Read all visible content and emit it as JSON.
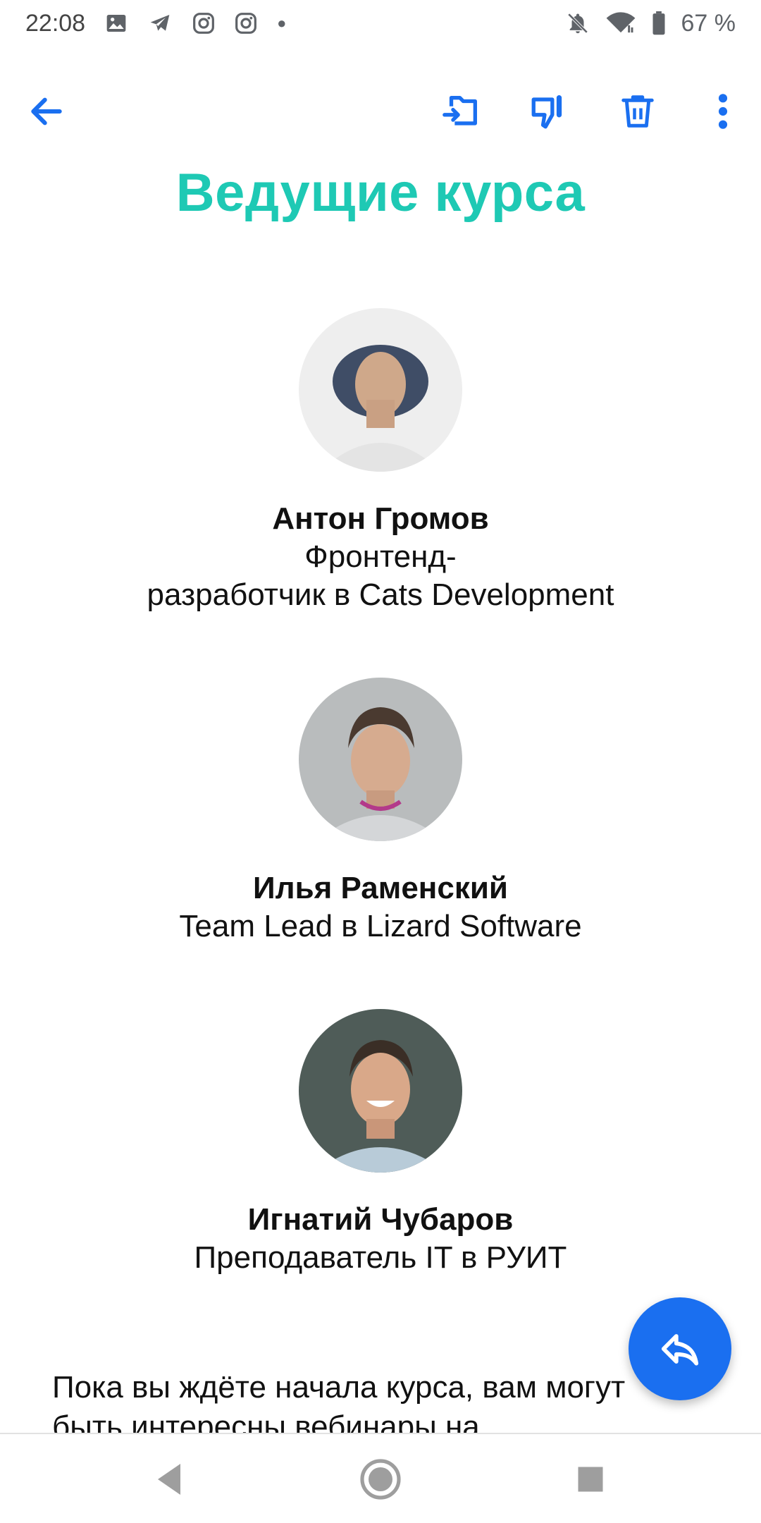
{
  "status_bar": {
    "time": "22:08",
    "battery": "67 %",
    "notification_icons": [
      "image-icon",
      "telegram-icon",
      "instagram-icon",
      "instagram-icon"
    ],
    "system_icons": [
      "bell-off-icon",
      "wifi-icon",
      "battery-icon"
    ]
  },
  "app_bar": {
    "actions": [
      "back-arrow-icon",
      "move-to-folder-icon",
      "thumbs-down-icon",
      "trash-icon",
      "more-vert-icon"
    ]
  },
  "page": {
    "title": "Ведущие курса"
  },
  "instructors": [
    {
      "name": "Антон Громов",
      "role": "Фронтенд-\nразработчик в Cats Development"
    },
    {
      "name": "Илья Раменский",
      "role": "Team Lead в Lizard Software"
    },
    {
      "name": "Игнатий Чубаров",
      "role": "Преподаватель IT в РУИТ"
    }
  ],
  "intro": {
    "text": "Пока вы ждёте начала курса, вам могут быть интересны вебинары на"
  },
  "colors": {
    "accent": "#1a6ff0",
    "title": "#1ec9b4"
  },
  "fab": {
    "icon": "reply-icon"
  },
  "nav": {
    "buttons": [
      "nav-back-icon",
      "nav-home-icon",
      "nav-recents-icon"
    ]
  }
}
